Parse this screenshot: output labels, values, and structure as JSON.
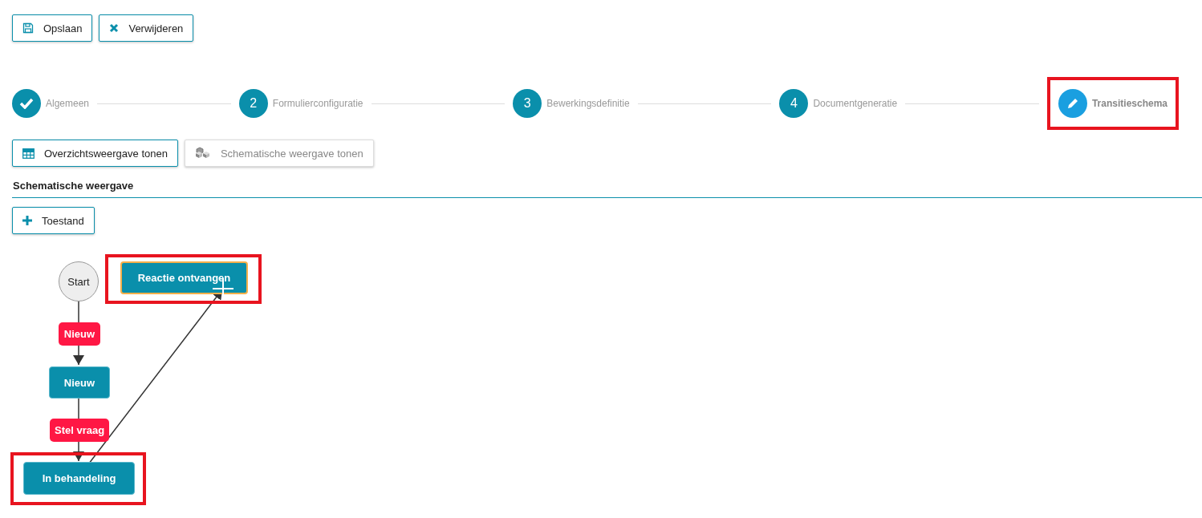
{
  "toolbar": [
    {
      "label": "Opslaan"
    },
    {
      "label": "Verwijderen"
    }
  ],
  "steps": [
    {
      "label": "Algemeen",
      "kind": "done",
      "highlighted": false
    },
    {
      "label": "Formulierconfiguratie",
      "marker": "2",
      "kind": "numbered",
      "highlighted": false
    },
    {
      "label": "Bewerkingsdefinitie",
      "marker": "3",
      "kind": "numbered",
      "highlighted": false
    },
    {
      "label": "Documentgeneratie",
      "marker": "4",
      "kind": "numbered",
      "highlighted": false
    },
    {
      "label": "Transitieschema",
      "kind": "current",
      "highlighted": true
    }
  ],
  "view_toggle": [
    {
      "label": "Overzichtsweergave tonen",
      "disabled": false
    },
    {
      "label": "Schematische weergave tonen",
      "disabled": true
    }
  ],
  "section_title": "Schematische weergave",
  "add_button": {
    "label": "Toestand"
  },
  "diagram": {
    "nodes": [
      {
        "label": "Start",
        "kind": "start",
        "selected": false,
        "highlighted": false
      },
      {
        "label": "Reactie ontvangen",
        "kind": "state",
        "selected": true,
        "highlighted": true
      },
      {
        "label": "Nieuw",
        "kind": "state",
        "selected": false,
        "highlighted": false
      },
      {
        "label": "In behandeling",
        "kind": "state",
        "selected": false,
        "highlighted": true
      }
    ],
    "transitions": [
      {
        "label": "Nieuw"
      },
      {
        "label": "Stel vraag"
      }
    ]
  }
}
